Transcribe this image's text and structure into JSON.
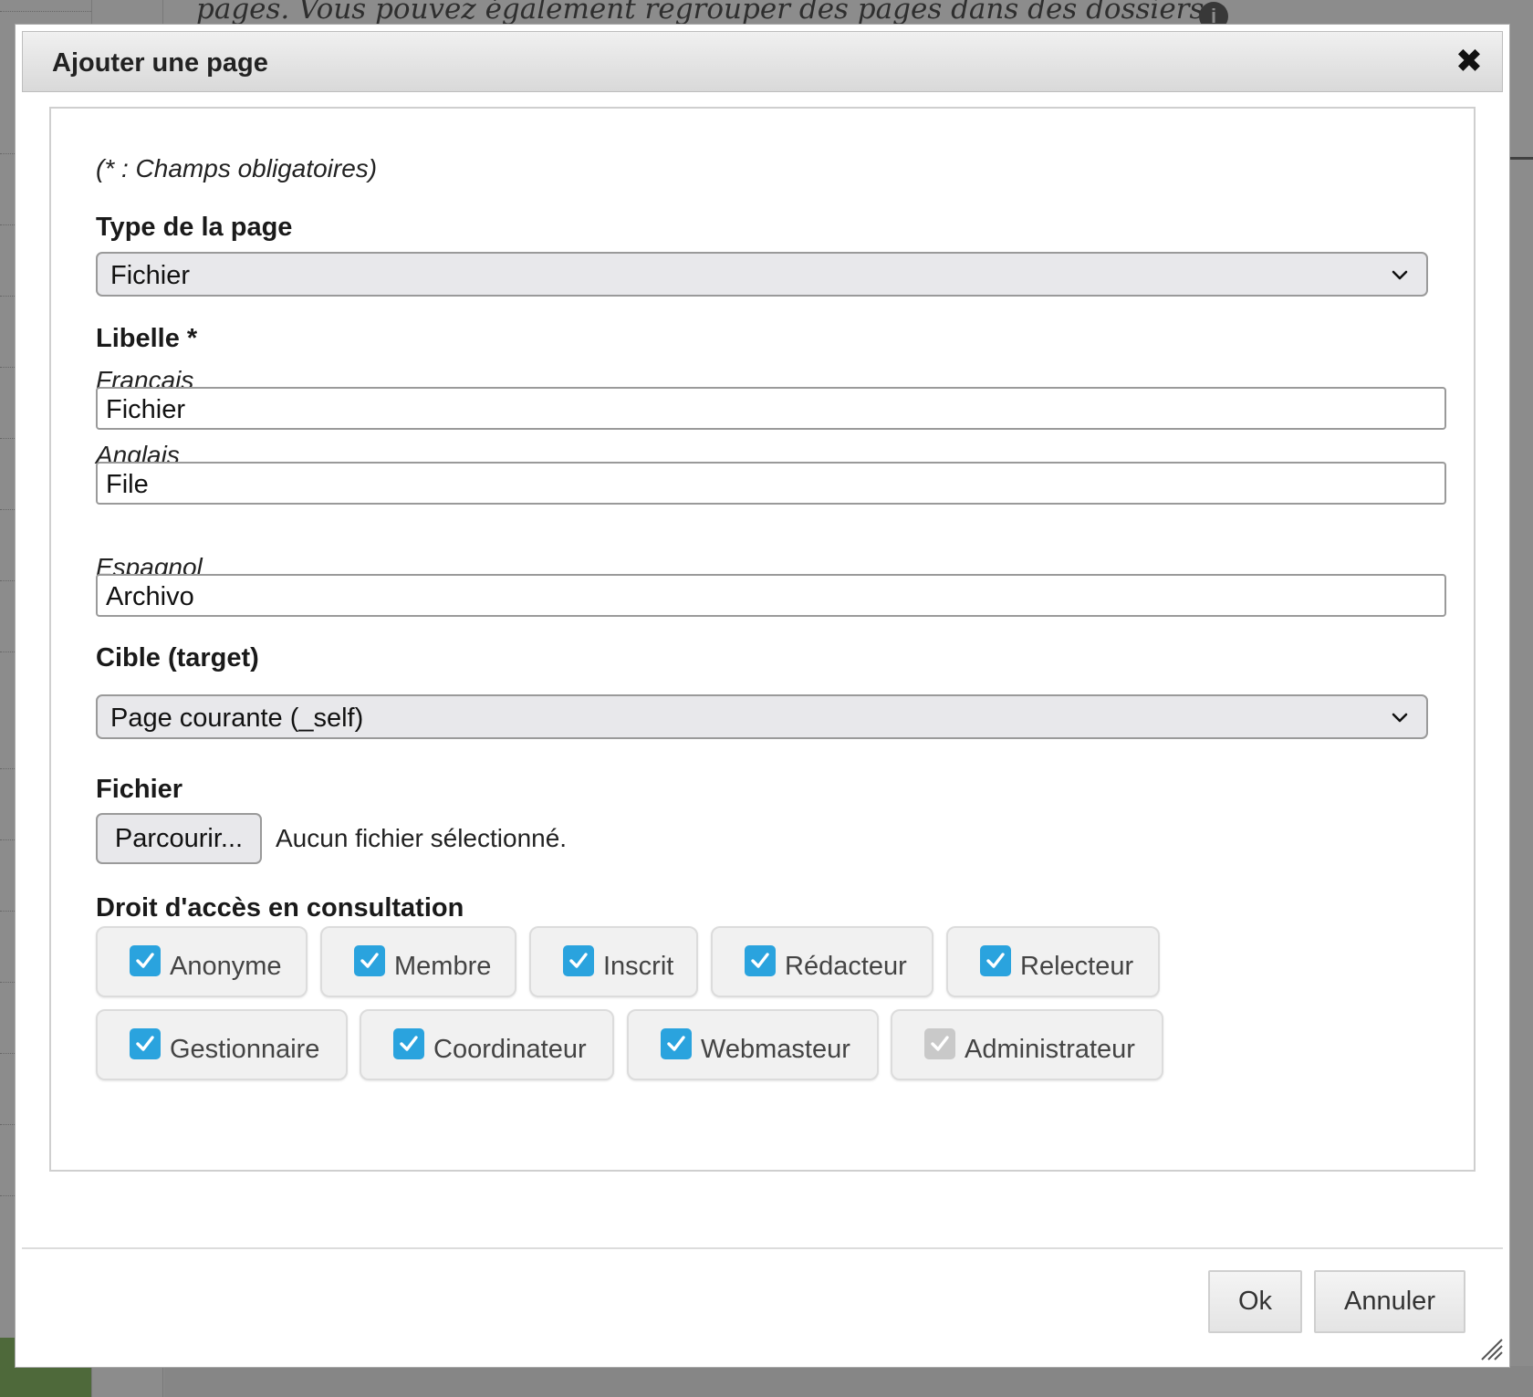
{
  "background": {
    "intro_text": "pages. Vous pouvez également regrouper des pages dans des dossiers.",
    "info_icon": "info-icon"
  },
  "dialog": {
    "title": "Ajouter une page",
    "close_icon": "close-icon",
    "required_note": "(* : Champs obligatoires)",
    "page_type": {
      "label": "Type de la page",
      "value": "Fichier"
    },
    "libelle": {
      "label": "Libelle *",
      "francais_label": "Français",
      "francais_value": "Fichier",
      "anglais_label": "Anglais",
      "anglais_value": "File",
      "espagnol_label": "Espagnol",
      "espagnol_value": "Archivo"
    },
    "target": {
      "label": "Cible (target)",
      "value": "Page courante (_self)"
    },
    "file": {
      "label": "Fichier",
      "browse_label": "Parcourir...",
      "status": "Aucun fichier sélectionné."
    },
    "access": {
      "label": "Droit d'accès en consultation",
      "roles": [
        {
          "label": "Anonyme",
          "checked": true,
          "disabled": false
        },
        {
          "label": "Membre",
          "checked": true,
          "disabled": false
        },
        {
          "label": "Inscrit",
          "checked": true,
          "disabled": false
        },
        {
          "label": "Rédacteur",
          "checked": true,
          "disabled": false
        },
        {
          "label": "Relecteur",
          "checked": true,
          "disabled": false
        },
        {
          "label": "Gestionnaire",
          "checked": true,
          "disabled": false
        },
        {
          "label": "Coordinateur",
          "checked": true,
          "disabled": false
        },
        {
          "label": "Webmasteur",
          "checked": true,
          "disabled": false
        },
        {
          "label": "Administrateur",
          "checked": true,
          "disabled": true
        }
      ]
    },
    "footer": {
      "ok_label": "Ok",
      "cancel_label": "Annuler"
    }
  },
  "colors": {
    "checkbox_checked": "#2aa3de",
    "checkbox_disabled": "#c9c9c9"
  }
}
